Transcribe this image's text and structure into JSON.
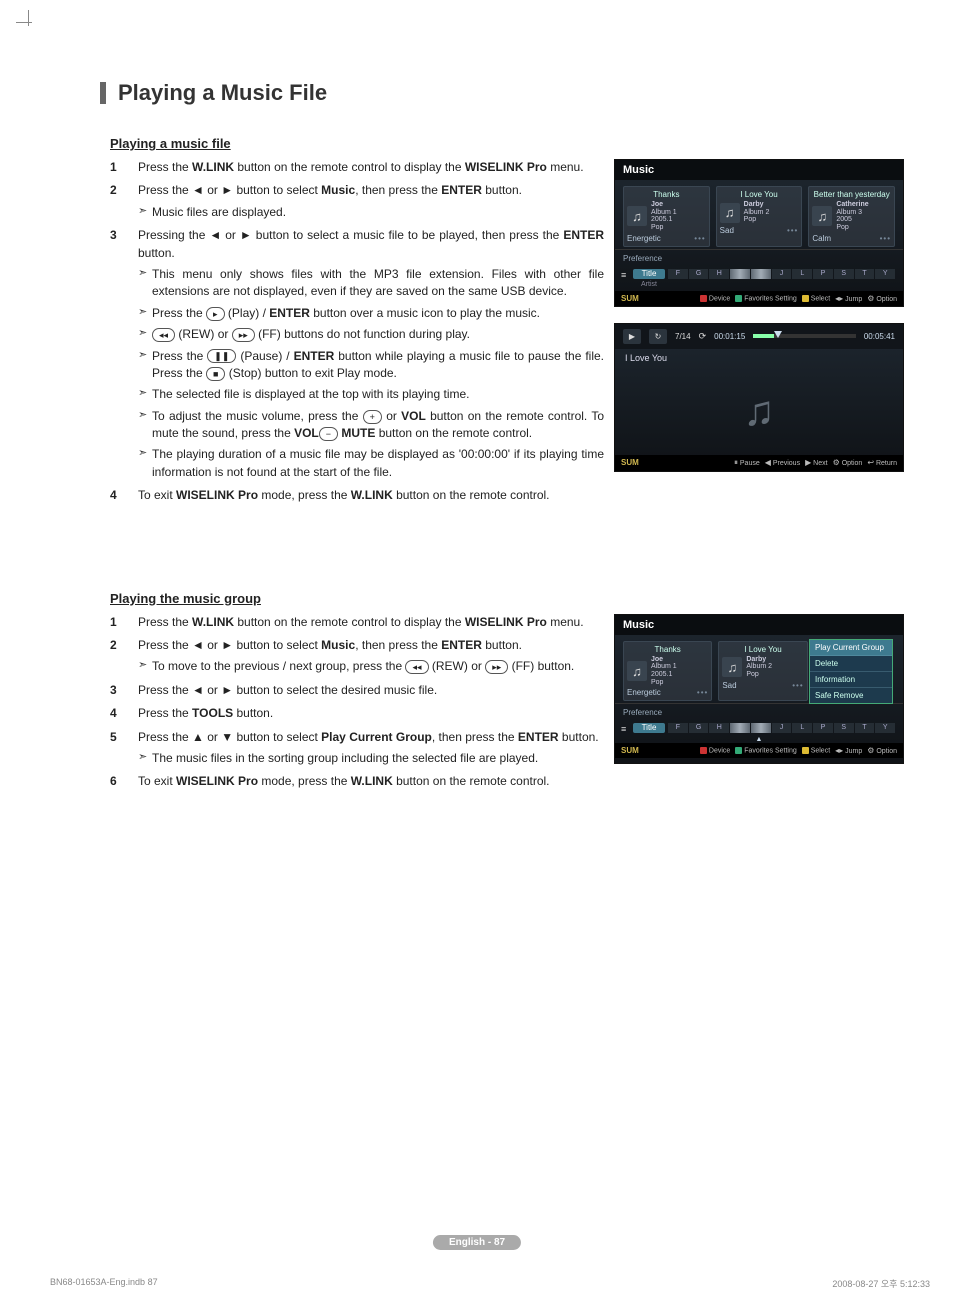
{
  "title": "Playing a Music File",
  "section1": {
    "heading": "Playing a music file",
    "steps": [
      {
        "n": "1",
        "body_pre": "Press the ",
        "b1": "W.LINK",
        "body_mid": " button on the remote control to display the ",
        "b2": "WISELINK Pro",
        "body_post": " menu."
      },
      {
        "n": "2",
        "body_pre": "Press the ◄ or ► button to select ",
        "b1": "Music",
        "body_mid": ", then press the ",
        "b2": "ENTER",
        "body_post": " button.",
        "subs": [
          {
            "t": "Music files are displayed."
          }
        ]
      },
      {
        "n": "3",
        "body_pre": "Pressing the ◄ or ► button to select a music file to be played, then press the ",
        "b1": "ENTER",
        "body_mid": "  button.",
        "subs": [
          {
            "t": "This menu only shows files with the MP3 file extension. Files with other file extensions are not displayed, even if they are saved on the same USB device."
          },
          {
            "pre": "Press the ",
            "key": "▸",
            "mid": " (Play) / ",
            "b": "ENTER",
            "post": "  button over a music icon to play the music."
          },
          {
            "key1": "◂◂",
            "mid1": " (REW) or ",
            "key2": "▸▸",
            "post": " (FF) buttons do not function during play."
          },
          {
            "pre": "Press the ",
            "key": "❚❚",
            "mid": " (Pause) / ",
            "b": "ENTER",
            "mid2": "  button while playing a music file to pause the file. Press the ",
            "key2": "■",
            "post": " (Stop) button to exit Play mode."
          },
          {
            "t": "The selected file is displayed at the top with its playing time."
          },
          {
            "pre": "To adjust the music volume, press the ",
            "b": "VOL",
            "key": "+",
            "mid": " or ",
            "b2": "VOL",
            "key2": "−",
            "mid2": " button on the remote control. To mute the sound, press the ",
            "b3": "MUTE",
            "post": " button on the remote control."
          },
          {
            "t": "The playing duration of a music file may be displayed as '00:00:00' if its playing time information is not found at the start of the file."
          }
        ]
      },
      {
        "n": "4",
        "body_pre": "To exit ",
        "b1": "WISELINK Pro",
        "body_mid": " mode, press the ",
        "b2": "W.LINK",
        "body_post": " button on the remote control.",
        "wide": true
      }
    ]
  },
  "section2": {
    "heading": "Playing the music group",
    "steps": [
      {
        "n": "1",
        "body_pre": "Press the ",
        "b1": "W.LINK",
        "body_mid": " button on the remote control to display the ",
        "b2": "WISELINK Pro",
        "body_post": " menu."
      },
      {
        "n": "2",
        "body_pre": "Press the ◄ or ► button to select ",
        "b1": "Music",
        "body_mid": ", then press the ",
        "b2": "ENTER",
        "body_post": " button.",
        "subs": [
          {
            "pre": "To move to the previous / next group, press the ",
            "key": "◂◂",
            "mid": " (REW) or ",
            "key2": "▸▸",
            "post": " (FF) button."
          }
        ]
      },
      {
        "n": "3",
        "body": "Press the ◄ or ► button to select the desired music file."
      },
      {
        "n": "4",
        "body_pre": "Press the ",
        "b1": "TOOLS",
        "body_post": " button."
      },
      {
        "n": "5",
        "body_pre": "Press the ▲ or ▼ button to select ",
        "b1": "Play Current Group",
        "body_mid": ", then press the ",
        "b2": "ENTER",
        "body_post": " button.",
        "subs": [
          {
            "t": "The music files in the sorting group including the selected file are played."
          }
        ]
      },
      {
        "n": "6",
        "body_pre": "To exit ",
        "b1": "WISELINK Pro",
        "body_mid": " mode, press the ",
        "b2": "W.LINK",
        "body_post": " button on the remote control."
      }
    ]
  },
  "screens": {
    "list": {
      "title": "Music",
      "cards": [
        {
          "top": "Thanks",
          "name": "Joe",
          "meta": "Album 1\n2005.1\nPop",
          "mood": "Energetic"
        },
        {
          "top": "I Love You",
          "name": "Darby",
          "meta": "Album 2\nPop",
          "mood": "Sad"
        },
        {
          "top": "Better than yesterday",
          "name": "Catherine",
          "meta": "Album 3\n2005\nPop",
          "mood": "Calm"
        }
      ],
      "pref": "Preference",
      "sorts": {
        "primary": "Title",
        "secondary": "Artist"
      },
      "letters": [
        "F",
        "G",
        "H",
        "",
        "",
        "J",
        "L",
        "P",
        "S",
        "T",
        "Y"
      ],
      "foot": {
        "sum": "SUM",
        "items": [
          "Device",
          "Favorites Setting",
          "Select",
          "Jump",
          "Option"
        ]
      }
    },
    "player": {
      "count": "7/14",
      "elapsed": "00:01:15",
      "total": "00:05:41",
      "song": "I Love You",
      "foot": {
        "sum": "SUM",
        "items": [
          "Pause",
          "Previous",
          "Next",
          "Option",
          "Return"
        ]
      }
    },
    "list2": {
      "title": "Music",
      "menu": [
        "Play Current Group",
        "Delete",
        "Information",
        "Safe Remove"
      ],
      "foot": {
        "sum": "SUM",
        "items": [
          "Device",
          "Favorites Setting",
          "Select",
          "Jump",
          "Option"
        ]
      }
    }
  },
  "page_badge": "English - 87",
  "doc_foot": {
    "left": "BN68-01653A-Eng.indb   87",
    "right": "2008-08-27   오후 5:12:33"
  }
}
